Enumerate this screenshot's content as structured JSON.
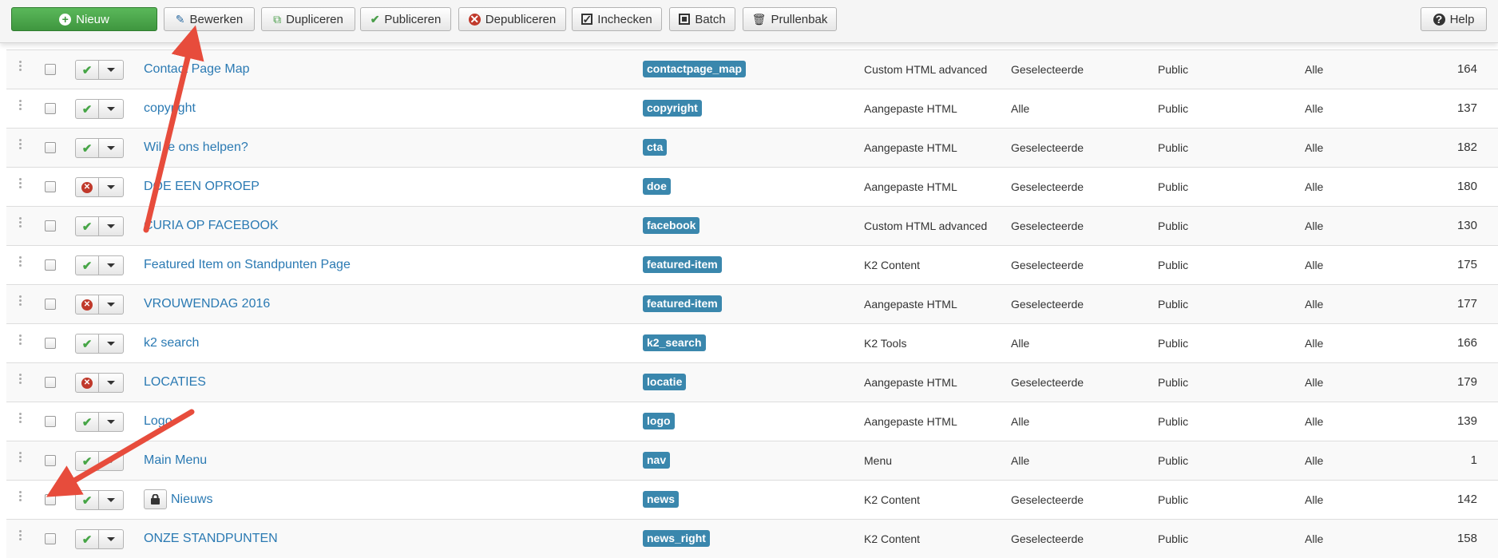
{
  "toolbar": {
    "new": "Nieuw",
    "edit": "Bewerken",
    "duplicate": "Dupliceren",
    "publish": "Publiceren",
    "unpublish": "Depubliceren",
    "checkin": "Inchecken",
    "batch": "Batch",
    "trash": "Prullenbak",
    "help": "Help"
  },
  "rows": [
    {
      "title": "Contact Page Map",
      "position": "contactpage_map",
      "type": "Custom HTML advanced",
      "pages": "Geselecteerde",
      "access": "Public",
      "language": "Alle",
      "id": "164",
      "published": true
    },
    {
      "title": "copyright",
      "position": "copyright",
      "type": "Aangepaste HTML",
      "pages": "Alle",
      "access": "Public",
      "language": "Alle",
      "id": "137",
      "published": true
    },
    {
      "title": "Wil je ons helpen?",
      "position": "cta",
      "type": "Aangepaste HTML",
      "pages": "Geselecteerde",
      "access": "Public",
      "language": "Alle",
      "id": "182",
      "published": true
    },
    {
      "title": "DOE EEN OPROEP",
      "position": "doe",
      "type": "Aangepaste HTML",
      "pages": "Geselecteerde",
      "access": "Public",
      "language": "Alle",
      "id": "180",
      "published": false
    },
    {
      "title": "CURIA OP FACEBOOK",
      "position": "facebook",
      "type": "Custom HTML advanced",
      "pages": "Geselecteerde",
      "access": "Public",
      "language": "Alle",
      "id": "130",
      "published": true
    },
    {
      "title": "Featured Item on Standpunten Page",
      "position": "featured-item",
      "type": "K2 Content",
      "pages": "Geselecteerde",
      "access": "Public",
      "language": "Alle",
      "id": "175",
      "published": true
    },
    {
      "title": "VROUWENDAG 2016",
      "position": "featured-item",
      "type": "Aangepaste HTML",
      "pages": "Geselecteerde",
      "access": "Public",
      "language": "Alle",
      "id": "177",
      "published": false
    },
    {
      "title": "k2 search",
      "position": "k2_search",
      "type": "K2 Tools",
      "pages": "Alle",
      "access": "Public",
      "language": "Alle",
      "id": "166",
      "published": true
    },
    {
      "title": "LOCATIES",
      "position": "locatie",
      "type": "Aangepaste HTML",
      "pages": "Geselecteerde",
      "access": "Public",
      "language": "Alle",
      "id": "179",
      "published": false
    },
    {
      "title": "Logo",
      "position": "logo",
      "type": "Aangepaste HTML",
      "pages": "Alle",
      "access": "Public",
      "language": "Alle",
      "id": "139",
      "published": true
    },
    {
      "title": "Main Menu",
      "position": "nav",
      "type": "Menu",
      "pages": "Alle",
      "access": "Public",
      "language": "Alle",
      "id": "1",
      "published": true
    },
    {
      "title": "Nieuws",
      "position": "news",
      "type": "K2 Content",
      "pages": "Geselecteerde",
      "access": "Public",
      "language": "Alle",
      "id": "142",
      "published": true,
      "locked": true
    },
    {
      "title": "ONZE STANDPUNTEN",
      "position": "news_right",
      "type": "K2 Content",
      "pages": "Geselecteerde",
      "access": "Public",
      "language": "Alle",
      "id": "158",
      "published": true
    }
  ],
  "colors": {
    "link": "#2b7ab3",
    "badge": "#3a87ad",
    "published": "#46a546",
    "unpublished": "#c0392b",
    "arrow": "#e74c3c"
  }
}
